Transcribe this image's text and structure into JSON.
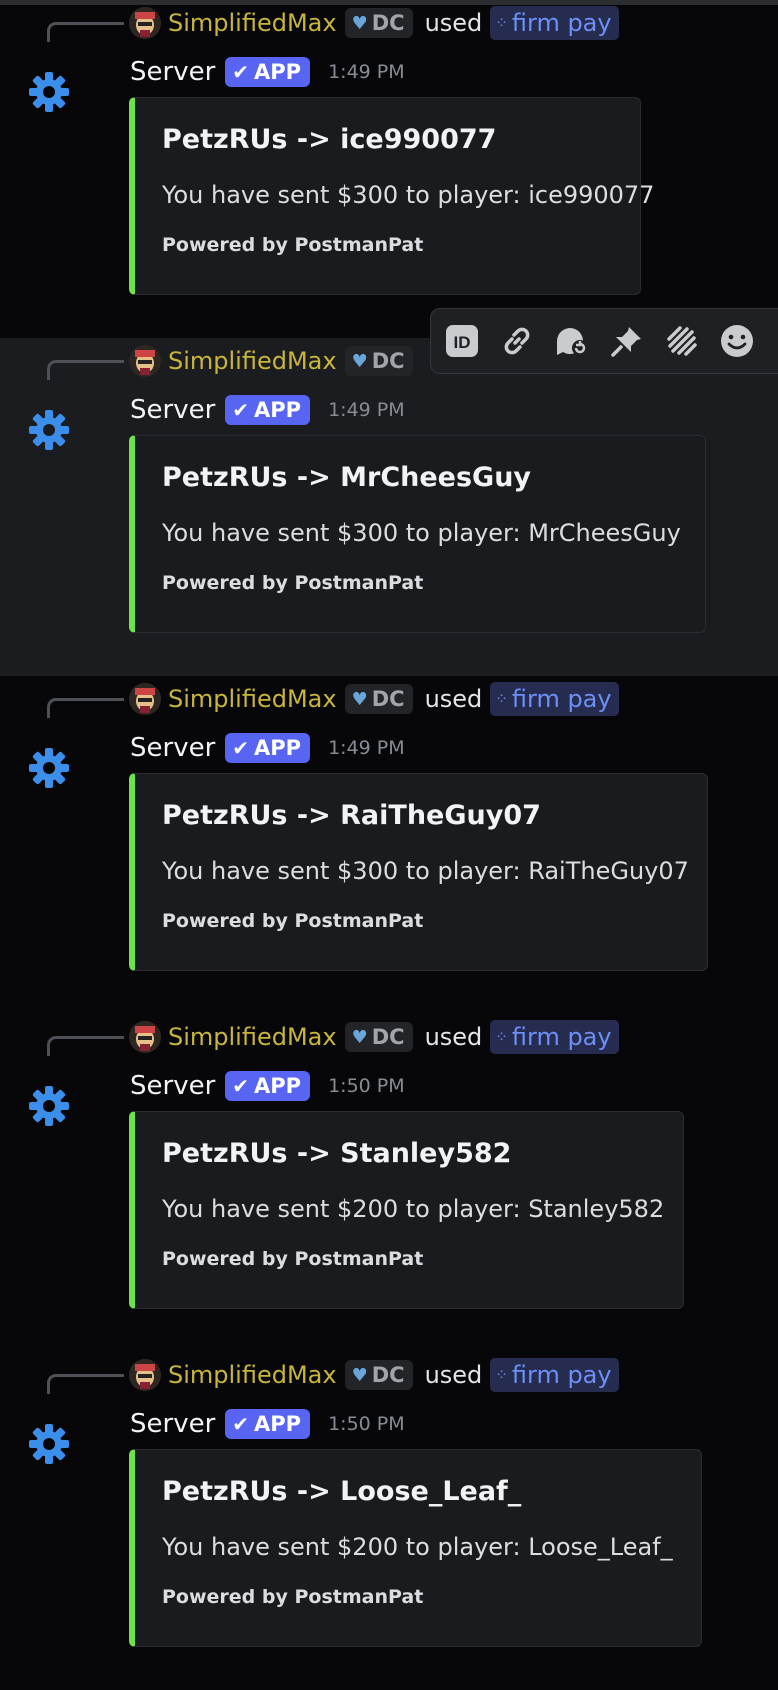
{
  "colors": {
    "background": "#070709",
    "hover_background": "#1b1c20",
    "embed_accent": "#6fe24b",
    "app_badge": "#5865f2",
    "username": "#c7b53c",
    "command": "#6d8ff6",
    "gear": "#3b8eea"
  },
  "messages": [
    {
      "ref_user": "SimplifiedMax",
      "ref_tag": "DC",
      "ref_used": "used",
      "ref_command": "firm pay",
      "author": "Server",
      "badge": "APP",
      "time": "1:49 PM",
      "embed_title": "PetzRUs -> ice990077",
      "embed_desc": "You have sent $300 to player: ice990077",
      "embed_footer": "Powered by PostmanPat"
    },
    {
      "ref_user": "SimplifiedMax",
      "ref_tag": "DC",
      "ref_used": "",
      "ref_command": "",
      "author": "Server",
      "badge": "APP",
      "time": "1:49 PM",
      "embed_title": "PetzRUs -> MrCheesGuy",
      "embed_desc": "You have sent $300 to player: MrCheesGuy",
      "embed_footer": "Powered by PostmanPat"
    },
    {
      "ref_user": "SimplifiedMax",
      "ref_tag": "DC",
      "ref_used": "used",
      "ref_command": "firm pay",
      "author": "Server",
      "badge": "APP",
      "time": "1:49 PM",
      "embed_title": "PetzRUs -> RaiTheGuy07",
      "embed_desc": "You have sent $300 to player: RaiTheGuy07",
      "embed_footer": "Powered by PostmanPat"
    },
    {
      "ref_user": "SimplifiedMax",
      "ref_tag": "DC",
      "ref_used": "used",
      "ref_command": "firm pay",
      "author": "Server",
      "badge": "APP",
      "time": "1:50 PM",
      "embed_title": "PetzRUs -> Stanley582",
      "embed_desc": "You have sent $200 to player: Stanley582",
      "embed_footer": "Powered by PostmanPat"
    },
    {
      "ref_user": "SimplifiedMax",
      "ref_tag": "DC",
      "ref_used": "used",
      "ref_command": "firm pay",
      "author": "Server",
      "badge": "APP",
      "time": "1:50 PM",
      "embed_title": "PetzRUs -> Loose_Leaf_",
      "embed_desc": "You have sent $200 to player: Loose_Leaf_",
      "embed_footer": "Powered by PostmanPat"
    }
  ],
  "toolbar": {
    "icons": [
      "copy-id-icon",
      "copy-link-icon",
      "create-thread-icon",
      "pin-icon",
      "apps-icon",
      "add-reaction-icon"
    ],
    "id_label": "ID"
  }
}
